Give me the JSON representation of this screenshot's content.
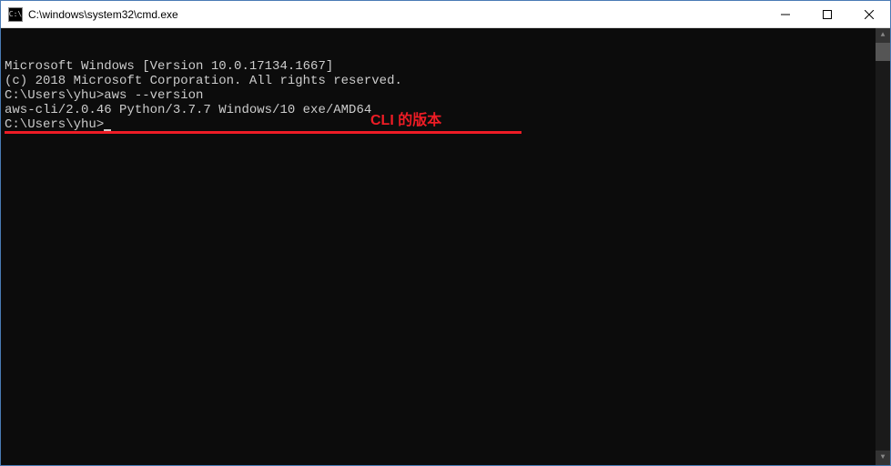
{
  "window": {
    "title": "C:\\windows\\system32\\cmd.exe",
    "icon_text": "C:\\"
  },
  "terminal": {
    "line1": "Microsoft Windows [Version 10.0.17134.1667]",
    "line2": "(c) 2018 Microsoft Corporation. All rights reserved.",
    "blank1": "",
    "prompt1": "C:\\Users\\yhu>aws --version",
    "output1": "aws-cli/2.0.46 Python/3.7.7 Windows/10 exe/AMD64",
    "blank2": "",
    "prompt2": "C:\\Users\\yhu>"
  },
  "annotation": {
    "label": "CLI 的版本"
  }
}
